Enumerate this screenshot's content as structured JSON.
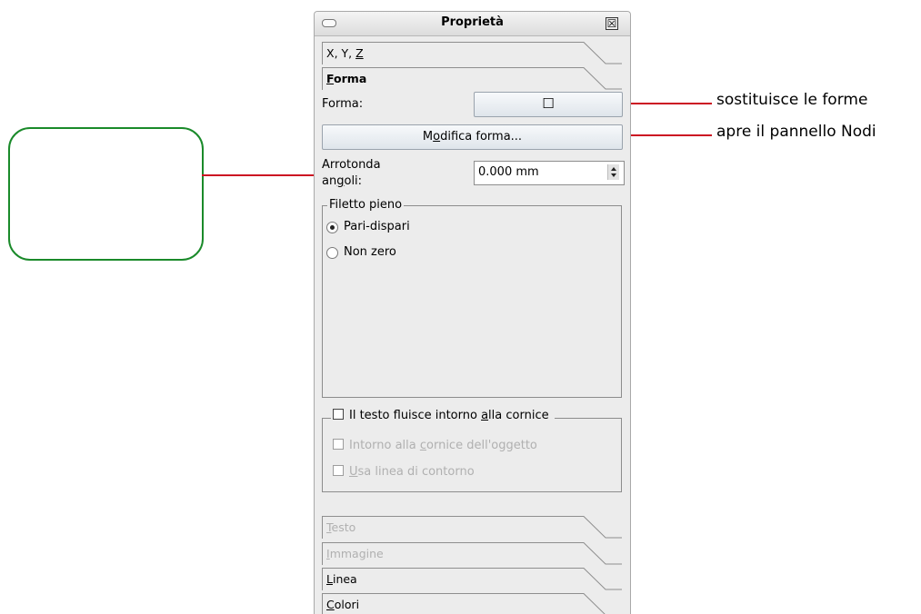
{
  "panel": {
    "title": "Proprietà",
    "close_glyph": "☒",
    "tabs_top": [
      {
        "pre": "X, Y, ",
        "u": "Z",
        "post": ""
      }
    ],
    "active_tab": {
      "pre": "",
      "u": "F",
      "post": "orma"
    },
    "forma_label": "Forma:",
    "forma_button_glyph": "☐",
    "modifica_button": {
      "pre": "M",
      "u": "o",
      "post": "difica forma..."
    },
    "arrotonda_label_line1": "Arrotonda",
    "arrotonda_label_line2": {
      "pre": "an",
      "u": "g",
      "post": "oli:"
    },
    "arrotonda_value": "0.000 mm",
    "filetto_group_title": "Filetto pieno",
    "radio_options": [
      {
        "label": "Pari-dispari",
        "selected": true
      },
      {
        "label": "Non zero",
        "selected": false
      }
    ],
    "text_flow_checkbox": {
      "pre": "Il testo fluisce intorno ",
      "u": "a",
      "post": "lla cornice",
      "checked": false
    },
    "text_flow_suboptions": [
      {
        "pre": "Intorno alla ",
        "u": "c",
        "post": "ornice dell'oggetto",
        "enabled": false
      },
      {
        "pre": "",
        "u": "U",
        "post": "sa linea di contorno",
        "enabled": false
      }
    ],
    "tabs_bottom": [
      {
        "pre": "",
        "u": "T",
        "post": "esto",
        "enabled": false
      },
      {
        "pre": "",
        "u": "I",
        "post": "mmagine",
        "enabled": false
      },
      {
        "pre": "",
        "u": "L",
        "post": "inea",
        "enabled": true
      },
      {
        "pre": "",
        "u": "C",
        "post": "olori",
        "enabled": true
      }
    ]
  },
  "callouts": {
    "forme": "sostituisce le forme",
    "nodi": "apre il pannello Nodi"
  },
  "colors": {
    "callout_line": "#cc1122",
    "rounded_shape_border": "#1a8a2a"
  }
}
